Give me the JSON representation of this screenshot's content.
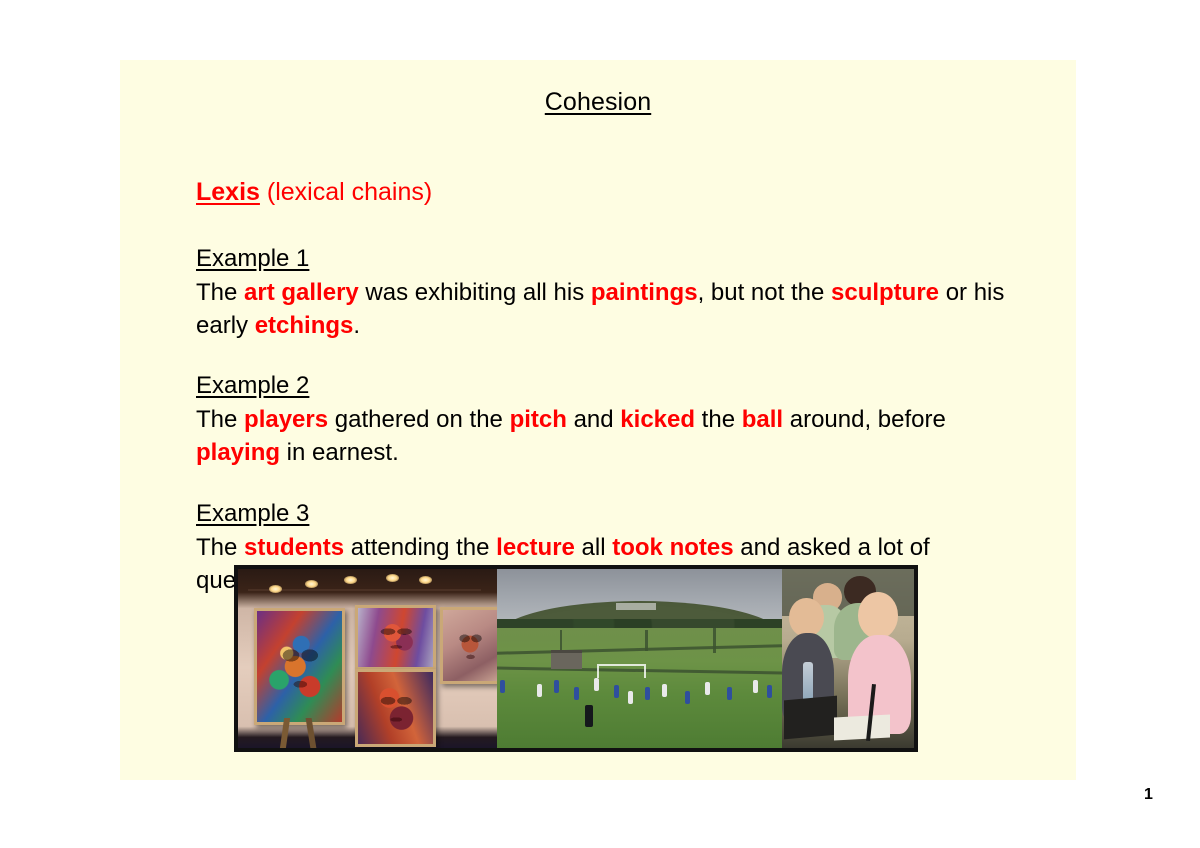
{
  "slide": {
    "title": "Cohesion",
    "subtitle": {
      "keyword": "Lexis",
      "rest": " (lexical chains)"
    },
    "examples": [
      {
        "heading": "Example 1",
        "segments": [
          {
            "text": "The ",
            "highlight": false
          },
          {
            "text": "art gallery",
            "highlight": true
          },
          {
            "text": " was exhibiting all his ",
            "highlight": false
          },
          {
            "text": "paintings",
            "highlight": true
          },
          {
            "text": ", but not the ",
            "highlight": false
          },
          {
            "text": "sculpture",
            "highlight": true
          },
          {
            "text": " or his early ",
            "highlight": false
          },
          {
            "text": "etchings",
            "highlight": true
          },
          {
            "text": ".",
            "highlight": false
          }
        ],
        "plain_text": "The art gallery was exhibiting all his paintings, but not the sculpture or his early etchings."
      },
      {
        "heading": "Example 2",
        "segments": [
          {
            "text": "The ",
            "highlight": false
          },
          {
            "text": "players",
            "highlight": true
          },
          {
            "text": " gathered on the ",
            "highlight": false
          },
          {
            "text": "pitch",
            "highlight": true
          },
          {
            "text": " and ",
            "highlight": false
          },
          {
            "text": "kicked",
            "highlight": true
          },
          {
            "text": " the ",
            "highlight": false
          },
          {
            "text": "ball",
            "highlight": true
          },
          {
            "text": " around, before ",
            "highlight": false
          },
          {
            "text": "playing",
            "highlight": true
          },
          {
            "text": " in earnest.",
            "highlight": false
          }
        ],
        "plain_text": "The players gathered on the pitch and kicked the ball around, before playing in earnest."
      },
      {
        "heading": "Example 3",
        "segments": [
          {
            "text": "The ",
            "highlight": false
          },
          {
            "text": "students",
            "highlight": true
          },
          {
            "text": " attending the ",
            "highlight": false
          },
          {
            "text": "lecture",
            "highlight": true
          },
          {
            "text": " all ",
            "highlight": false
          },
          {
            "text": "took notes",
            "highlight": true
          },
          {
            "text": " and asked a lot of questions.",
            "highlight": false
          }
        ],
        "plain_text": "The students attending the lecture all took notes and asked a lot of questions."
      }
    ],
    "photos": [
      {
        "name": "art-gallery-photo",
        "caption": "Art gallery interior with colourful expressionist portrait paintings on the walls"
      },
      {
        "name": "football-pitch-photo",
        "caption": "Football players in blue and white kit on a grass pitch below a green hillside"
      },
      {
        "name": "lecture-students-photo",
        "caption": "Students seated in a lecture taking notes with laptops and papers"
      }
    ],
    "background_color": "#fefde2",
    "highlight_color": "#ff0000",
    "text_color": "#000000"
  },
  "page": {
    "number": "1",
    "background_color": "#ffffff"
  }
}
